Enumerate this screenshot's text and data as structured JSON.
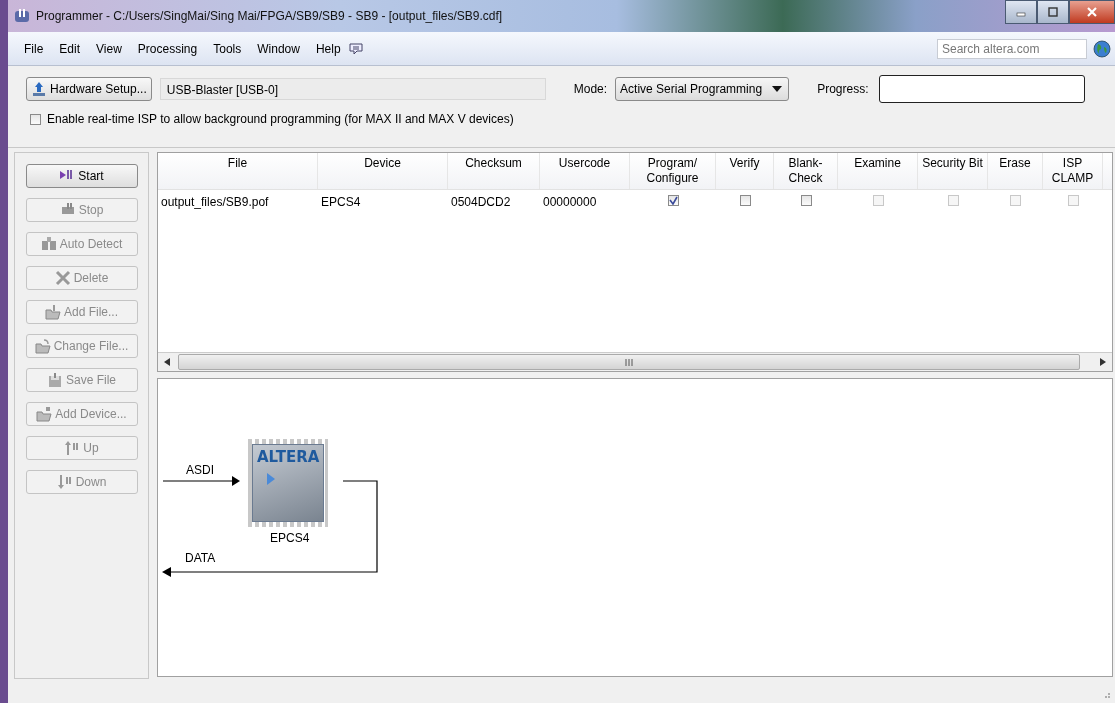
{
  "window": {
    "title": "Programmer - C:/Users/SingMai/Sing Mai/FPGA/SB9/SB9 - SB9 - [output_files/SB9.cdf]"
  },
  "menu": [
    "File",
    "Edit",
    "View",
    "Processing",
    "Tools",
    "Window",
    "Help"
  ],
  "search": {
    "placeholder": "Search altera.com"
  },
  "hardware": {
    "button": "Hardware Setup...",
    "device": "USB-Blaster [USB-0]",
    "mode_label": "Mode:",
    "mode": "Active Serial Programming",
    "progress_label": "Progress:"
  },
  "isp_option": {
    "label": "Enable real-time ISP to allow background programming (for MAX II and MAX V devices)",
    "checked": false
  },
  "actions": [
    {
      "label": "Start",
      "disabled": false
    },
    {
      "label": "Stop",
      "disabled": true
    },
    {
      "label": "Auto Detect",
      "disabled": true
    },
    {
      "label": "Delete",
      "disabled": true
    },
    {
      "label": "Add File...",
      "disabled": true
    },
    {
      "label": "Change File...",
      "disabled": true
    },
    {
      "label": "Save File",
      "disabled": true
    },
    {
      "label": "Add Device...",
      "disabled": true
    },
    {
      "label": "Up",
      "disabled": true
    },
    {
      "label": "Down",
      "disabled": true
    }
  ],
  "table": {
    "columns": [
      "File",
      "Device",
      "Checksum",
      "Usercode",
      "Program/ Configure",
      "Verify",
      "Blank- Check",
      "Examine",
      "Security Bit",
      "Erase",
      "ISP CLAMP"
    ],
    "rows": [
      {
        "cells": [
          "output_files/SB9.pof",
          "EPCS4",
          "0504DCD2",
          "00000000"
        ],
        "options": [
          {
            "checked": true,
            "disabled": false
          },
          {
            "checked": false,
            "disabled": false
          },
          {
            "checked": false,
            "disabled": false
          },
          {
            "checked": false,
            "disabled": true
          },
          {
            "checked": false,
            "disabled": true
          },
          {
            "checked": false,
            "disabled": true
          },
          {
            "checked": false,
            "disabled": true
          }
        ]
      }
    ]
  },
  "diagram": {
    "input_label": "ASDI",
    "output_label": "DATA",
    "chip_logo": "ALTERA",
    "chip_name": "EPCS4"
  }
}
